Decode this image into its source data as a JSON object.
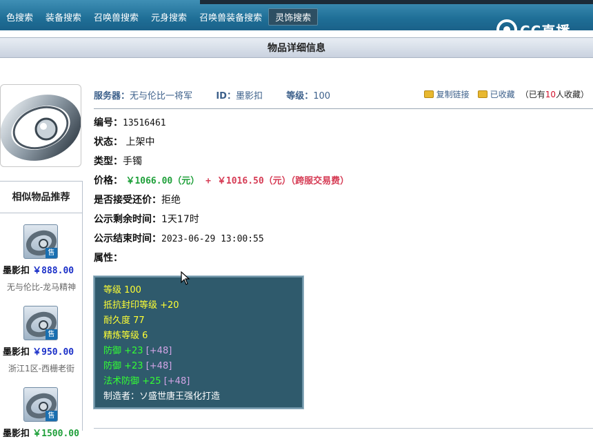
{
  "nav": {
    "items": [
      "色搜索",
      "装备搜索",
      "召唤兽搜索",
      "元身搜索",
      "召唤兽装备搜索",
      "灵饰搜索"
    ],
    "active_index": 5
  },
  "logo": {
    "text": "CC直播"
  },
  "page_title": "物品详细信息",
  "header": {
    "server_label": "服务器：",
    "server_value": "无与伦比一将军",
    "id_label": "ID：",
    "id_value": "墨影扣",
    "level_label": "等级：",
    "level_value": "100",
    "copy_link": "复制链接",
    "collected": "已收藏",
    "collect_prefix": "（已有",
    "collect_count": "10",
    "collect_suffix": "人收藏）"
  },
  "details": {
    "number_label": "编号：",
    "number_value": "13516461",
    "status_label": "状态：",
    "status_value": "上架中",
    "type_label": "类型：",
    "type_value": "手镯",
    "price_label": "价格：",
    "price_main": "￥1066.00（元）",
    "price_plus": "+",
    "price_fee": "￥1016.50（元）（跨服交易费）",
    "bargain_label": "是否接受还价：",
    "bargain_value": "拒绝",
    "remain_label": "公示剩余时间：",
    "remain_value": "1天17时",
    "end_label": "公示结束时间：",
    "end_value": "2023-06-29 13:00:55",
    "attr_label": "属性："
  },
  "attributes": [
    {
      "parts": [
        {
          "t": "等级 100",
          "c": "yellow"
        }
      ]
    },
    {
      "parts": [
        {
          "t": "抵抗封印等级 +20",
          "c": "yellow"
        }
      ]
    },
    {
      "parts": [
        {
          "t": "耐久度 77",
          "c": "yellow"
        }
      ]
    },
    {
      "parts": [
        {
          "t": "精炼等级 6",
          "c": "yellow"
        }
      ]
    },
    {
      "parts": [
        {
          "t": "防御 +23 ",
          "c": "green"
        },
        {
          "t": "[+48]",
          "c": "purple"
        }
      ]
    },
    {
      "parts": [
        {
          "t": "防御 +23 ",
          "c": "green"
        },
        {
          "t": "[+48]",
          "c": "purple"
        }
      ]
    },
    {
      "parts": [
        {
          "t": "法术防御 +25 ",
          "c": "green"
        },
        {
          "t": "[+48]",
          "c": "purple"
        }
      ]
    },
    {
      "parts": [
        {
          "t": "制造者：ソ盛世唐王强化打造",
          "c": "white"
        }
      ]
    }
  ],
  "sidebar": {
    "title": "相似物品推荐",
    "sell_badge": "售",
    "items": [
      {
        "name": "墨影扣",
        "price": "￥888.00",
        "server": "无与伦比-龙马精神"
      },
      {
        "name": "墨影扣",
        "price": "￥950.00",
        "server": "浙江1区-西栅老街"
      },
      {
        "name": "墨影扣",
        "price": "￥1500.00",
        "server": ""
      }
    ]
  },
  "colors": {
    "nav_bg": "#1f6f97",
    "price_green": "#1fa03a",
    "price_red": "#d63c55",
    "attr_bg": "#2f5a6c"
  }
}
